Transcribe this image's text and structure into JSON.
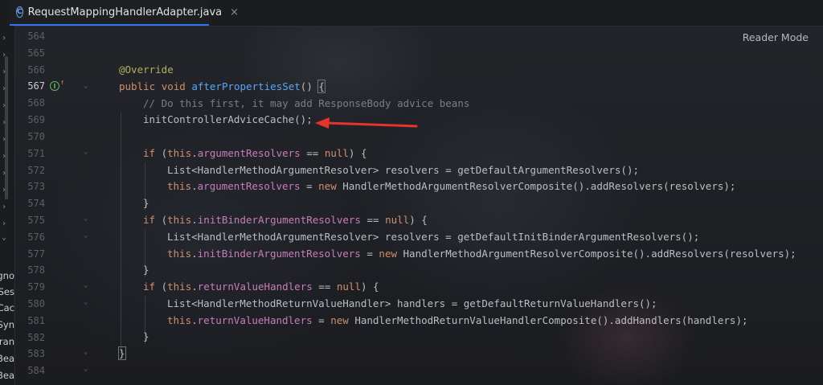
{
  "tab": {
    "filename": "RequestMappingHandlerAdapter.java",
    "close": "×",
    "icon_letter": "C"
  },
  "reader_mode": "Reader Mode",
  "sidebar_labels": [
    "gno",
    "Ses",
    "Cac",
    "Syn",
    "ran",
    "Bea",
    "Bea"
  ],
  "line_numbers": [
    "564",
    "565",
    "566",
    "567",
    "568",
    "569",
    "570",
    "571",
    "572",
    "573",
    "574",
    "575",
    "576",
    "577",
    "578",
    "579",
    "580",
    "581",
    "582",
    "583",
    "584"
  ],
  "code": {
    "l566": "@Override",
    "l567_kw1": "public",
    "l567_kw2": "void",
    "l567_fn": "afterPropertiesSet",
    "l567_rest": "() ",
    "l567_brace": "{",
    "l568": "// Do this first, it may add ResponseBody advice beans",
    "l569": "initControllerAdviceCache();",
    "l571_kw1": "if",
    "l571_a": " (",
    "l571_kw2": "this",
    "l571_b": ".",
    "l571_fld": "argumentResolvers",
    "l571_c": " == ",
    "l571_kw3": "null",
    "l571_d": ") {",
    "l572": "List<HandlerMethodArgumentResolver> resolvers = getDefaultArgumentResolvers();",
    "l573_kw1": "this",
    "l573_a": ".",
    "l573_fld": "argumentResolvers",
    "l573_b": " = ",
    "l573_kw2": "new",
    "l573_c": " HandlerMethodArgumentResolverComposite().addResolvers(resolvers);",
    "l574": "}",
    "l575_kw1": "if",
    "l575_a": " (",
    "l575_kw2": "this",
    "l575_b": ".",
    "l575_fld": "initBinderArgumentResolvers",
    "l575_c": " == ",
    "l575_kw3": "null",
    "l575_d": ") {",
    "l576": "List<HandlerMethodArgumentResolver> resolvers = getDefaultInitBinderArgumentResolvers();",
    "l577_kw1": "this",
    "l577_a": ".",
    "l577_fld": "initBinderArgumentResolvers",
    "l577_b": " = ",
    "l577_kw2": "new",
    "l577_c": " HandlerMethodArgumentResolverComposite().addResolvers(resolvers);",
    "l578": "}",
    "l579_kw1": "if",
    "l579_a": " (",
    "l579_kw2": "this",
    "l579_b": ".",
    "l579_fld": "returnValueHandlers",
    "l579_c": " == ",
    "l579_kw3": "null",
    "l579_d": ") {",
    "l580": "List<HandlerMethodReturnValueHandler> handlers = getDefaultReturnValueHandlers();",
    "l581_kw1": "this",
    "l581_a": ".",
    "l581_fld": "returnValueHandlers",
    "l581_b": " = ",
    "l581_kw2": "new",
    "l581_c": " HandlerMethodReturnValueHandlerComposite().addHandlers(handlers);",
    "l582": "}",
    "l583": "}"
  },
  "colors": {
    "keyword": "#cf8e6d",
    "method": "#56a8f5",
    "field": "#c77dbb",
    "annotation": "#b3ae60",
    "comment": "#7a7e85",
    "arrow": "#e8322c",
    "tab_accent": "#3574f0"
  }
}
